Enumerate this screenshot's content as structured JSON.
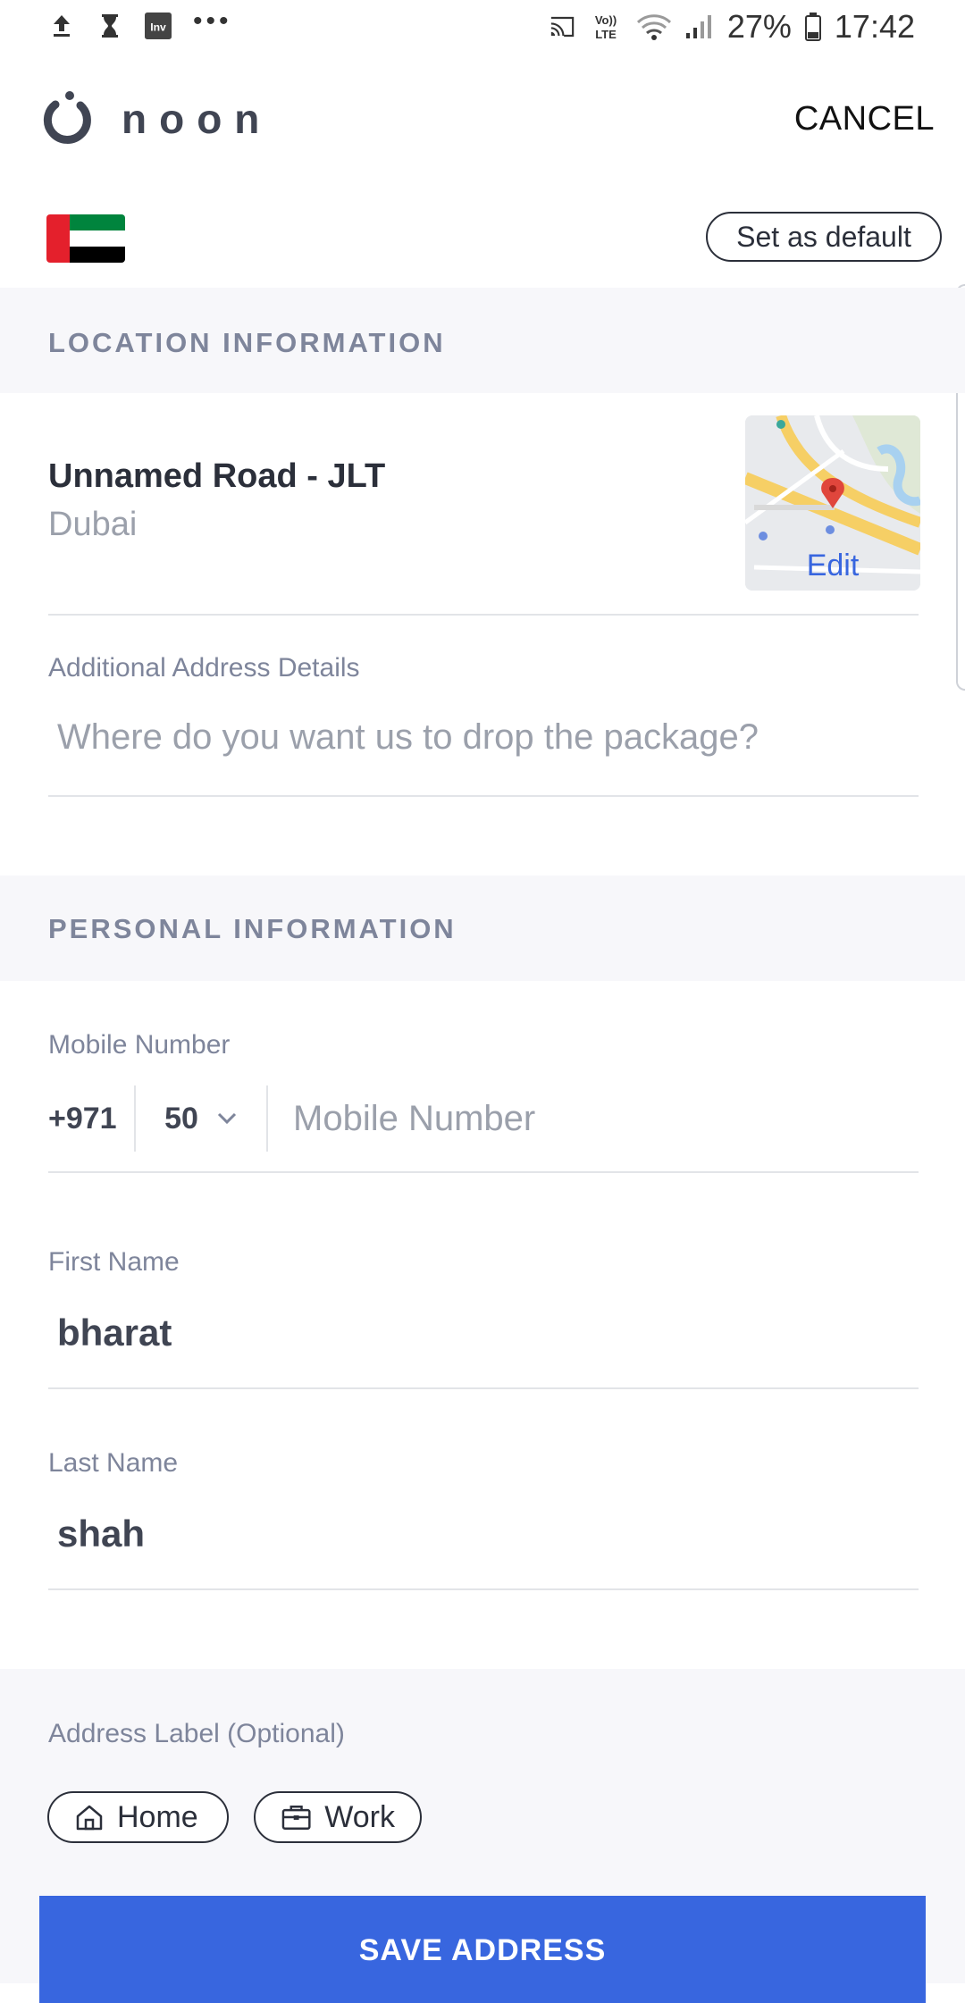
{
  "status_bar": {
    "battery": "27%",
    "time": "17:42",
    "icons": [
      "upload-icon",
      "hourglass-icon",
      "inv-app-icon",
      "more-dots-icon",
      "cast-icon",
      "volte-icon",
      "wifi-icon",
      "signal-icon",
      "battery-icon"
    ],
    "inv_label": "Inv",
    "volte_label": "Vo)) LTE"
  },
  "header": {
    "brand": "noon",
    "cancel_label": "CANCEL"
  },
  "country": {
    "flag": "uae-flag",
    "set_default_label": "Set as default"
  },
  "location": {
    "section_title": "LOCATION INFORMATION",
    "street": "Unnamed Road - JLT",
    "city": "Dubai",
    "map_edit_label": "Edit",
    "additional_label": "Additional Address Details",
    "additional_placeholder": "Where do you want us to drop the package?"
  },
  "personal": {
    "section_title": "PERSONAL INFORMATION",
    "mobile_label": "Mobile Number",
    "country_code": "+971",
    "prefix": "50",
    "mobile_placeholder": "Mobile Number",
    "first_name_label": "First Name",
    "first_name": "bharat",
    "last_name_label": "Last Name",
    "last_name": "shah"
  },
  "address_label": {
    "title": "Address Label (Optional)",
    "home_label": "Home",
    "work_label": "Work"
  },
  "save_label": "SAVE ADDRESS",
  "colors": {
    "accent": "#3866df",
    "text_dark": "#404553",
    "muted": "#7e859b",
    "section_bg": "#f7f7fa"
  }
}
